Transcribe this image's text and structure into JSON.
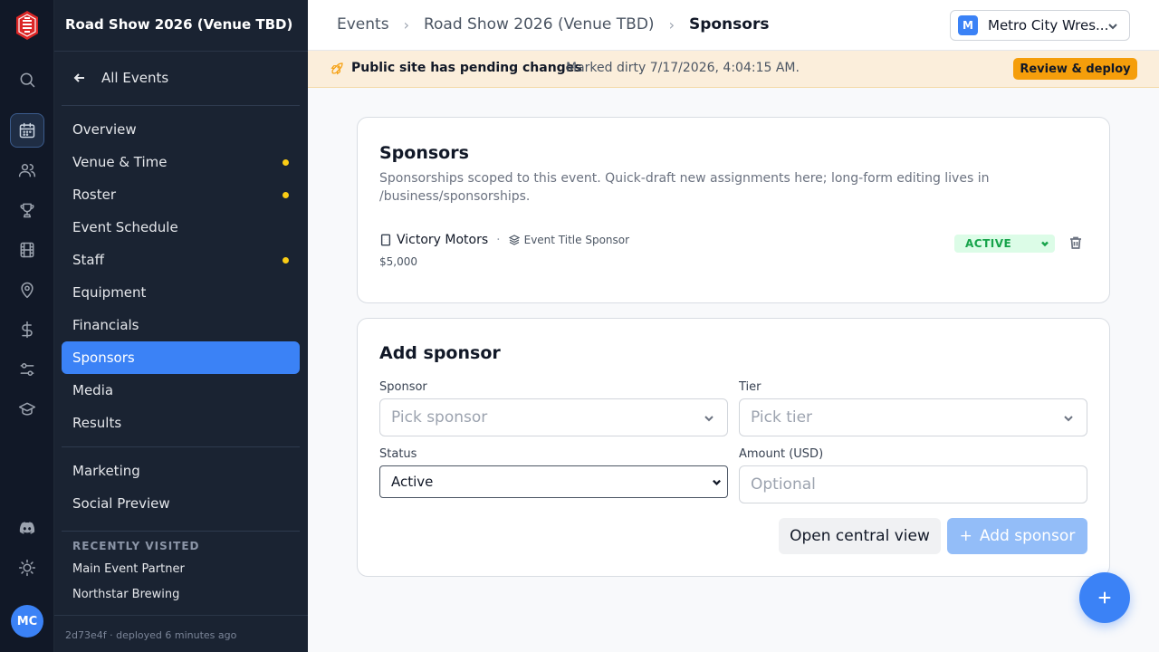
{
  "rail": {
    "icons": [
      "logo-icon",
      "search-icon",
      "calendar-icon",
      "users-icon",
      "trophy-icon",
      "film-icon",
      "map-pin-icon",
      "dollar-icon",
      "sliders-icon",
      "graduation-cap-icon",
      "discord-icon",
      "sun-icon"
    ],
    "active": "calendar-icon",
    "avatar": "MC"
  },
  "sidebar": {
    "title": "Road Show 2026 (Venue TBD)",
    "back_label": "All Events",
    "items": [
      {
        "label": "Overview",
        "dot": false
      },
      {
        "label": "Venue & Time",
        "dot": true
      },
      {
        "label": "Roster",
        "dot": true
      },
      {
        "label": "Event Schedule",
        "dot": false
      },
      {
        "label": "Staff",
        "dot": true
      },
      {
        "label": "Equipment",
        "dot": false
      },
      {
        "label": "Financials",
        "dot": false
      },
      {
        "label": "Sponsors",
        "dot": false,
        "active": true
      },
      {
        "label": "Media",
        "dot": false
      },
      {
        "label": "Results",
        "dot": false
      }
    ],
    "secondary_items": [
      {
        "label": "Marketing"
      },
      {
        "label": "Social Preview"
      }
    ],
    "recent_heading": "RECENTLY VISITED",
    "recent": [
      "Main Event Partner",
      "Northstar Brewing"
    ],
    "footer": "2d73e4f · deployed 6 minutes ago"
  },
  "header": {
    "breadcrumbs": [
      "Events",
      "Road Show 2026 (Venue TBD)",
      "Sponsors"
    ],
    "org_badge": "M",
    "org_name": "Metro City Wres..."
  },
  "banner": {
    "title": "Public site has pending changes",
    "subtitle": "Marked dirty 7/17/2026, 4:04:15 AM.",
    "button": "Review & deploy"
  },
  "sponsors_card": {
    "title": "Sponsors",
    "description": "Sponsorships scoped to this event. Quick-draft new assignments here; long-form editing lives in /business/sponsorships.",
    "rows": [
      {
        "name": "Victory Motors",
        "tier": "Event Title Sponsor",
        "amount": "$5,000",
        "status": "ACTIVE"
      }
    ]
  },
  "add_card": {
    "title": "Add sponsor",
    "sponsor_label": "Sponsor",
    "sponsor_placeholder": "Pick sponsor",
    "tier_label": "Tier",
    "tier_placeholder": "Pick tier",
    "status_label": "Status",
    "status_value": "Active",
    "amount_label": "Amount (USD)",
    "amount_placeholder": "Optional",
    "secondary_button": "Open central view",
    "primary_button": "Add sponsor",
    "primary_icon": "+"
  },
  "colors": {
    "accent": "#3b82f6",
    "warning": "#f59e0b",
    "success": "#16a34a",
    "sidebar_bg": "#1a2332",
    "rail_bg": "#111827"
  }
}
